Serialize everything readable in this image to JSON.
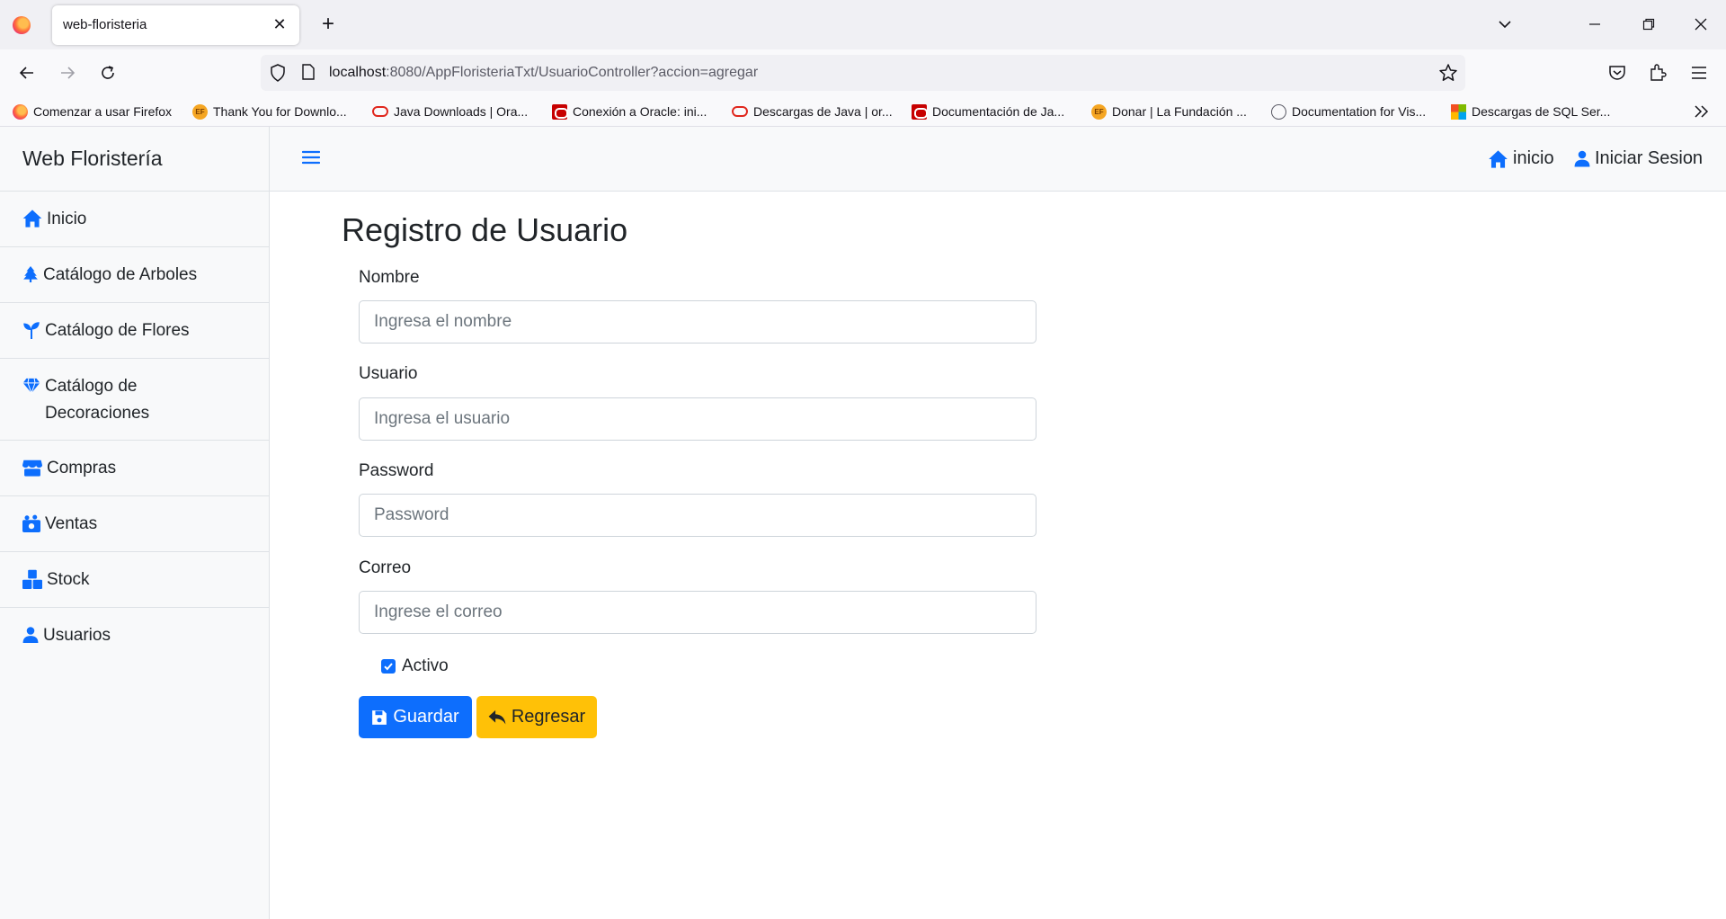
{
  "browser": {
    "tab_title": "web-floristeria",
    "tab_close": "✕",
    "new_tab": "+",
    "url_host": "localhost",
    "url_rest": ":8080/AppFloristeriaTxt/UsuarioController?accion=agregar",
    "bookmarks": [
      {
        "label": "Comenzar a usar Firefox",
        "icon": "firefox-icon"
      },
      {
        "label": "Thank You for Downlo...",
        "icon": "ef-icon"
      },
      {
        "label": "Java Downloads | Ora...",
        "icon": "oracle-icon"
      },
      {
        "label": "Conexión a Oracle: ini...",
        "icon": "oracle-box-icon"
      },
      {
        "label": "Descargas de Java | or...",
        "icon": "oracle-icon"
      },
      {
        "label": "Documentación de Ja...",
        "icon": "oracle-box-icon"
      },
      {
        "label": "Donar | La Fundación ...",
        "icon": "ef-icon"
      },
      {
        "label": "Documentation for Vis...",
        "icon": "globe-icon"
      },
      {
        "label": "Descargas de SQL Ser...",
        "icon": "microsoft-icon"
      }
    ],
    "ef_badge": "EF"
  },
  "app": {
    "brand": "Web Floristería",
    "sidebar": [
      {
        "label": "Inicio",
        "icon": "house-icon"
      },
      {
        "label": "Catálogo de Arboles",
        "icon": "tree-icon"
      },
      {
        "label": "Catálogo de Flores",
        "icon": "sprout-icon"
      },
      {
        "label": "Catálogo de Decoraciones",
        "icon": "gem-icon"
      },
      {
        "label": "Compras",
        "icon": "shop-icon"
      },
      {
        "label": "Ventas",
        "icon": "cash-icon"
      },
      {
        "label": "Stock",
        "icon": "boxes-icon"
      },
      {
        "label": "Usuarios",
        "icon": "user-icon"
      }
    ],
    "topbar": {
      "home_label": "inicio",
      "login_label": "Iniciar Sesion"
    }
  },
  "form": {
    "title": "Registro de Usuario",
    "nombre_label": "Nombre",
    "nombre_placeholder": "Ingresa el nombre",
    "usuario_label": "Usuario",
    "usuario_placeholder": "Ingresa el usuario",
    "password_label": "Password",
    "password_placeholder": "Password",
    "correo_label": "Correo",
    "correo_placeholder": "Ingrese el correo",
    "activo_label": "Activo",
    "activo_checked": true,
    "save_label": "Guardar",
    "back_label": "Regresar"
  },
  "colors": {
    "primary": "#0d6efd",
    "warning": "#ffc107",
    "sidebar_bg": "#f8f9fa"
  }
}
